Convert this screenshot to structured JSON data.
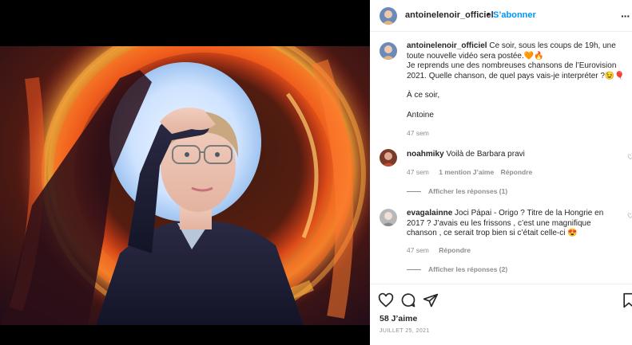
{
  "post": {
    "username": "antoinelenoir_officiel",
    "follow_label": "S’abonner",
    "header_dot": "•",
    "more_icon": "···"
  },
  "caption": {
    "username": "antoinelenoir_officiel",
    "line1": " Ce soir, sous les coups de 19h, une toute nouvelle vidéo sera postée.🧡🔥",
    "line2": "Je reprends une des nombreuses chansons de l’Eurovision 2021. Quelle chanson, de quel pays vais-je interpréter ?😉🎈",
    "line3": "À ce soir,",
    "line4": "Antoine",
    "time": "47 sem"
  },
  "comments": [
    {
      "username": "noahmiky",
      "text": " Voilà de Barbara pravi",
      "time": "47 sem",
      "likes": "1 mention J’aime",
      "reply": "Répondre",
      "replies": "Afficher les réponses (1)"
    },
    {
      "username": "evagalainne",
      "text": " Joci Pápai - Origo ? Titre de la Hongrie en 2017 ? J’avais eu les frissons , c’est une magnifique chanson , ce serait trop bien si c’était celle-ci 😍",
      "time": "47 sem",
      "reply": "Répondre",
      "replies": "Afficher les réponses (2)"
    }
  ],
  "footer": {
    "likes": "58 J’aime",
    "date": "JUILLET 25, 2021"
  },
  "icons": {
    "like": "heart-icon",
    "comment": "comment-icon",
    "share": "paper-plane-icon",
    "save": "bookmark-icon"
  },
  "colors": {
    "link_blue": "#0095f6",
    "muted": "#8e8e8e",
    "text": "#262626"
  }
}
